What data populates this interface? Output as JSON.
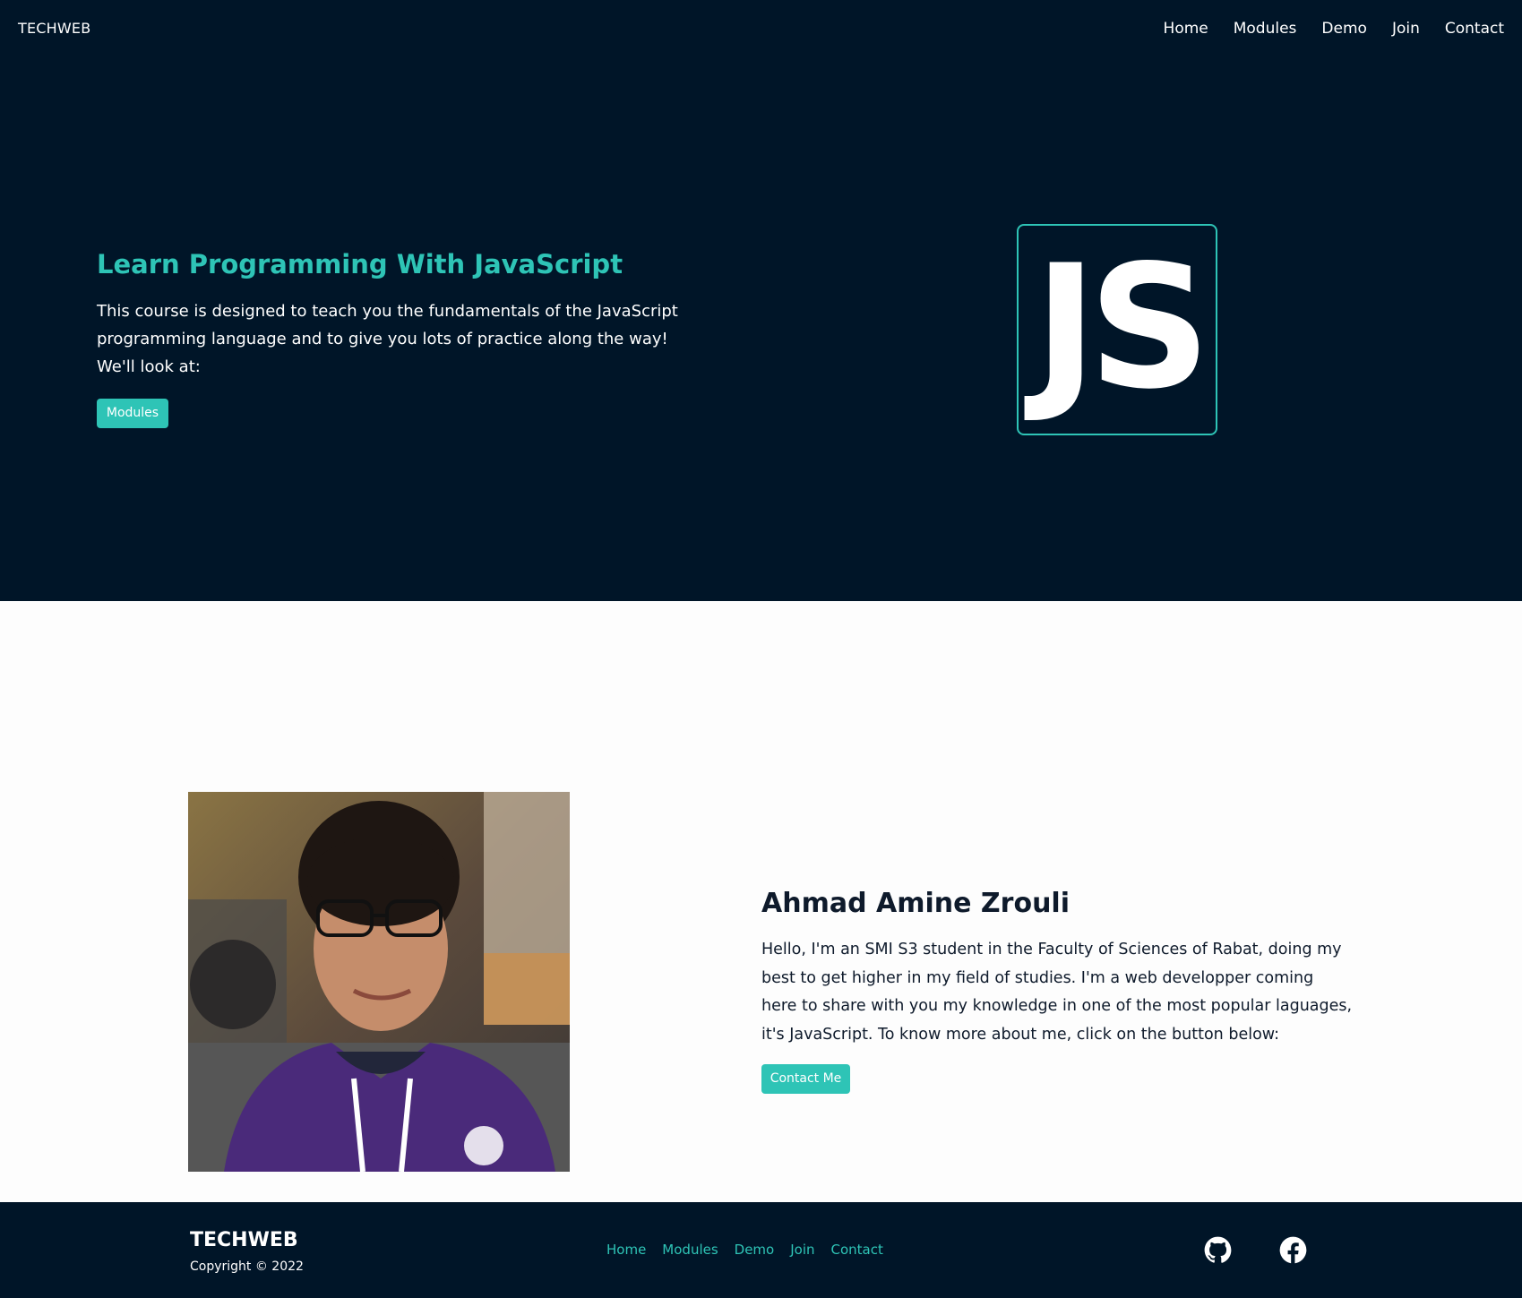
{
  "navbar": {
    "brand": "TECHWEB",
    "links": [
      "Home",
      "Modules",
      "Demo",
      "Join",
      "Contact"
    ]
  },
  "hero": {
    "title": "Learn Programming With JavaScript",
    "text": "This course is designed to teach you the fundamentals of the JavaScript programming language and to give you lots of practice along the way! We'll look at:",
    "button": "Modules",
    "logo_text": "JS"
  },
  "about": {
    "name": "Ahmad Amine Zrouli",
    "text": "Hello, I'm an SMI S3 student in the Faculty of Sciences of Rabat, doing my best to get higher in my field of studies. I'm a web developper coming here to share with you my knowledge in one of the most popular laguages, it's JavaScript. To know more about me, click on the button below:",
    "button": "Contact Me"
  },
  "footer": {
    "brand": "TECHWEB",
    "copyright": "Copyright © 2022",
    "links": [
      "Home",
      "Modules",
      "Demo",
      "Join",
      "Contact"
    ],
    "social": [
      "github-icon",
      "facebook-icon"
    ]
  },
  "colors": {
    "dark": "#001528",
    "accent": "#2ec4b6",
    "light": "#fdfdfd"
  }
}
